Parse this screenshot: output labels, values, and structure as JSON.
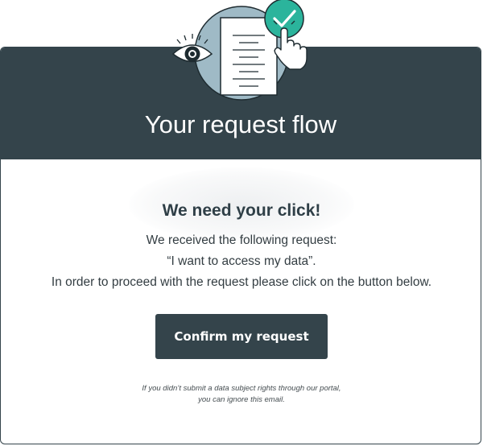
{
  "header": {
    "title": "Your request flow"
  },
  "illustration": {
    "icons": [
      "eye-icon",
      "document-icon",
      "check-icon",
      "hand-pointer-icon"
    ],
    "colors": {
      "circle": "#9fbac6",
      "check_badge": "#2bb49c",
      "ink": "#1e2b30"
    }
  },
  "main": {
    "headline": "We need your click!",
    "line1": "We received the following request:",
    "line2": "“I want to access my data”.",
    "line3": "In order to proceed with the request please click on the button below."
  },
  "actions": {
    "confirm_label": "Confirm my request"
  },
  "footer": {
    "line1": "If you didn’t submit a data subject rights through our portal,",
    "line2": "you can ignore this email."
  },
  "colors": {
    "header_bg": "#34444b",
    "button_bg": "#34444b",
    "headline_text": "#2f3f47",
    "accent": "#2bb49c"
  }
}
